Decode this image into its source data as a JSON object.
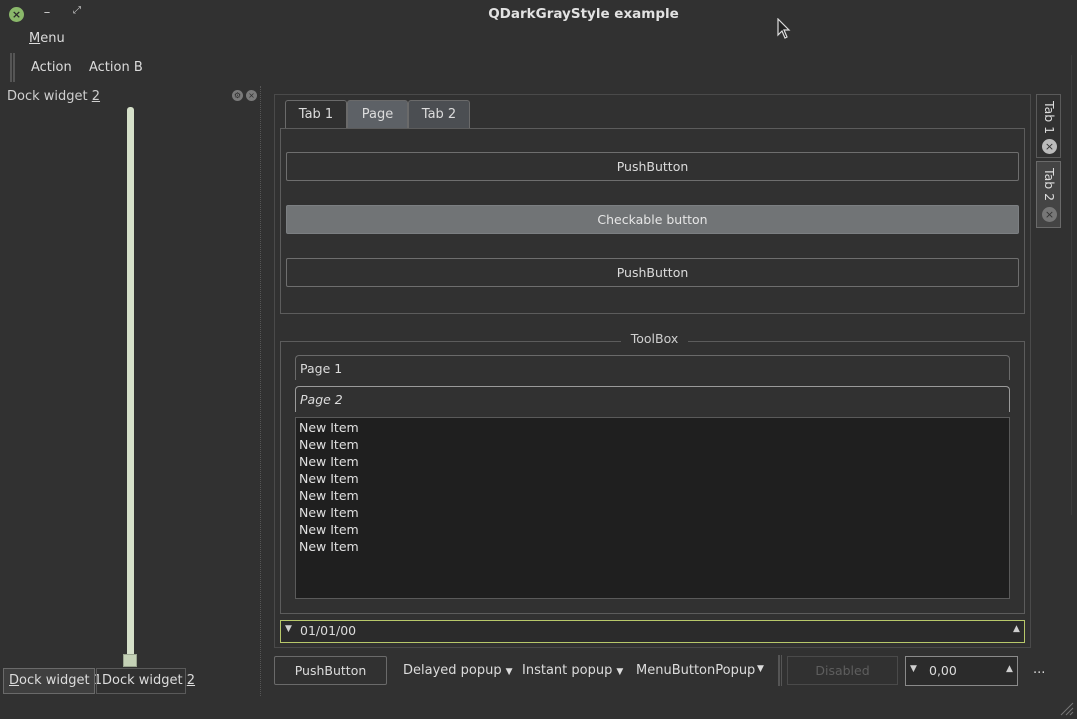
{
  "window": {
    "title": "QDarkGrayStyle example",
    "close_glyph": "×",
    "min_glyph": "–",
    "max_glyph": "⤢"
  },
  "menubar": {
    "menu_label": "Menu"
  },
  "toolbar": {
    "action_a": "Action",
    "action_b": "Action B"
  },
  "dock": {
    "title_prefix": "Dock widget ",
    "title_mnemonic": "2",
    "slider_value": 0,
    "tabs": [
      {
        "prefix": "",
        "mnemonic": "D",
        "suffix": "ock widget 1"
      },
      {
        "prefix": "Dock widget ",
        "mnemonic": "2",
        "suffix": ""
      }
    ]
  },
  "tabs": {
    "tab1": "Tab 1",
    "page": "Page",
    "tab2": "Tab 2"
  },
  "buttons": {
    "push1": "PushButton",
    "checkable": "Checkable button",
    "push2": "PushButton"
  },
  "toolbox": {
    "title": "ToolBox",
    "page1": "Page 1",
    "page2": "Page 2",
    "items": [
      "New Item",
      "New Item",
      "New Item",
      "New Item",
      "New Item",
      "New Item",
      "New Item",
      "New Item"
    ]
  },
  "date_edit": {
    "value": "01/01/00"
  },
  "side_tabs": {
    "tab1": "Tab 1",
    "tab2": "Tab 2"
  },
  "bottom_toolbar": {
    "push": "PushButton",
    "delayed": "Delayed popup",
    "instant": "Instant popup",
    "menu_popup": "MenuButtonPopup",
    "disabled": "Disabled",
    "spin_value": "0,00",
    "extension": "..."
  },
  "colors": {
    "background": "#313131",
    "accent": "#b8c86a",
    "slider": "#d5e0c9"
  }
}
